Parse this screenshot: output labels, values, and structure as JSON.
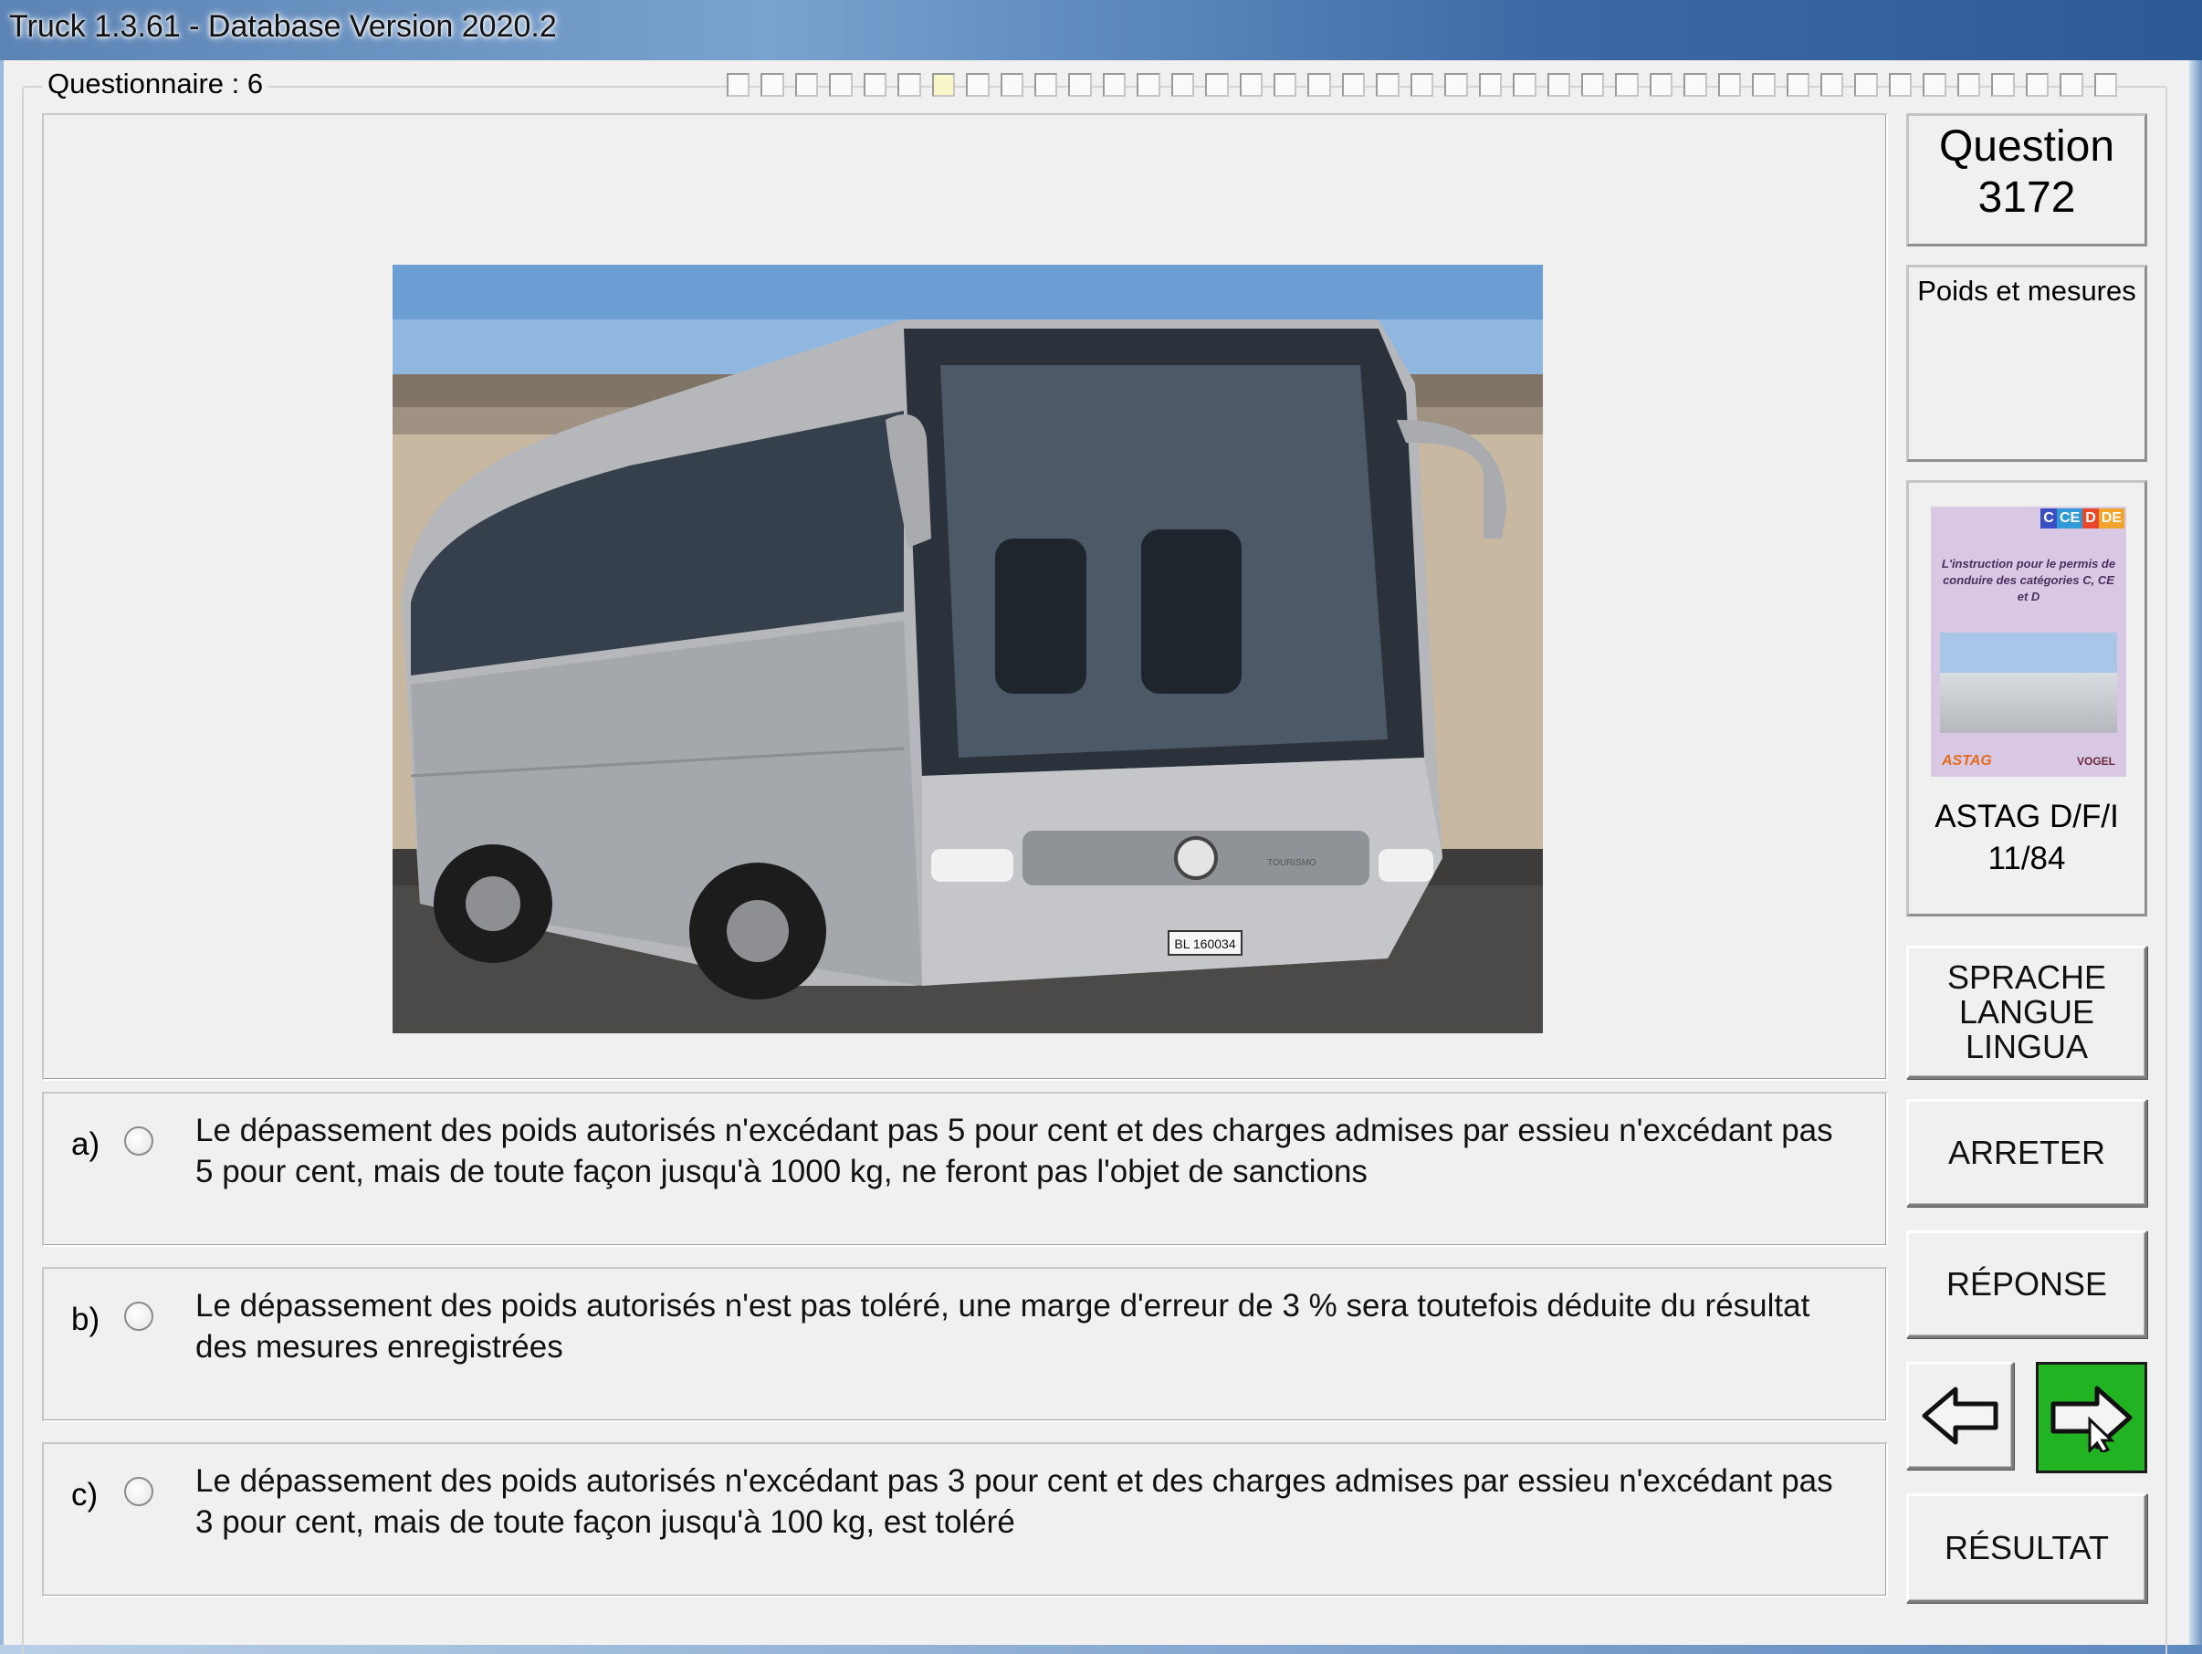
{
  "window": {
    "title": "Truck 1.3.61 - Database Version 2020.2"
  },
  "questionnaire": {
    "label": "Questionnaire : 6",
    "progress_total": 41,
    "progress_current": 7
  },
  "question": {
    "label": "Question",
    "number": "3172",
    "category": "Poids et mesures"
  },
  "source": {
    "book_tags": [
      "C",
      "CE",
      "D",
      "DE"
    ],
    "book_text": "L'instruction pour le permis de conduire des catégories C, CE et D",
    "book_logo_left": "ASTAG",
    "book_logo_right": "VOGEL",
    "name": "ASTAG D/F/I",
    "page": "11/84"
  },
  "photo": {
    "plate": "BL 160034",
    "badge": "TOURISMO"
  },
  "answers": [
    {
      "letter": "a)",
      "text": "Le dépassement des poids autorisés n'excédant pas 5 pour cent et des charges admises par essieu n'excédant pas 5 pour cent, mais de toute façon jusqu'à 1000 kg, ne feront pas l'objet de sanctions",
      "selected": false
    },
    {
      "letter": "b)",
      "text": "Le dépassement des poids autorisés n'est pas toléré, une marge d'erreur de 3 % sera toutefois déduite du résultat des mesures enregistrées",
      "selected": false
    },
    {
      "letter": "c)",
      "text": "Le dépassement des poids autorisés n'excédant pas 3 pour cent et des charges admises par essieu n'excédant pas 3 pour cent, mais de toute façon jusqu'à 100 kg, est toléré",
      "selected": false
    }
  ],
  "buttons": {
    "language_lines": [
      "SPRACHE",
      "LANGUE",
      "LINGUA"
    ],
    "stop": "ARRETER",
    "answer": "RÉPONSE",
    "result": "RÉSULTAT",
    "prev_icon": "arrow-left-icon",
    "next_icon": "arrow-right-icon",
    "next_color": "#22b322"
  }
}
